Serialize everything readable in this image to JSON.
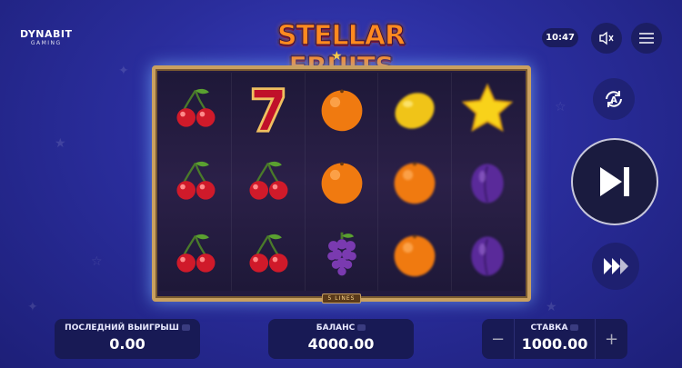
{
  "provider": {
    "name": "DYNABIT",
    "sub": "GAMING"
  },
  "game_title": "STELLAR FRUITS",
  "clock": "10:47",
  "icons": {
    "sound": "mute-icon",
    "menu": "hamburger-menu-icon",
    "autoplay": "autoplay-icon",
    "spin": "play-next-icon",
    "turbo": "fast-forward-icon"
  },
  "reels": [
    [
      "cherry",
      "cherry",
      "cherry"
    ],
    [
      "seven",
      "cherry",
      "cherry"
    ],
    [
      "orange",
      "orange",
      "grapes"
    ],
    [
      "lemon",
      "orange",
      "orange"
    ],
    [
      "star",
      "plum",
      "plum"
    ]
  ],
  "lines_label": "5 LINES",
  "last_win": {
    "label": "ПОСЛЕДНИЙ ВЫИГРЫШ",
    "value": "0.00"
  },
  "balance": {
    "label": "БАЛАНС",
    "value": "4000.00"
  },
  "bet": {
    "label": "СТАВКА",
    "value": "1000.00",
    "minus": "−",
    "plus": "+"
  },
  "colors": {
    "accent": "#ff8a1f",
    "frame": "#c9a060",
    "background": "#2a2d9c"
  }
}
